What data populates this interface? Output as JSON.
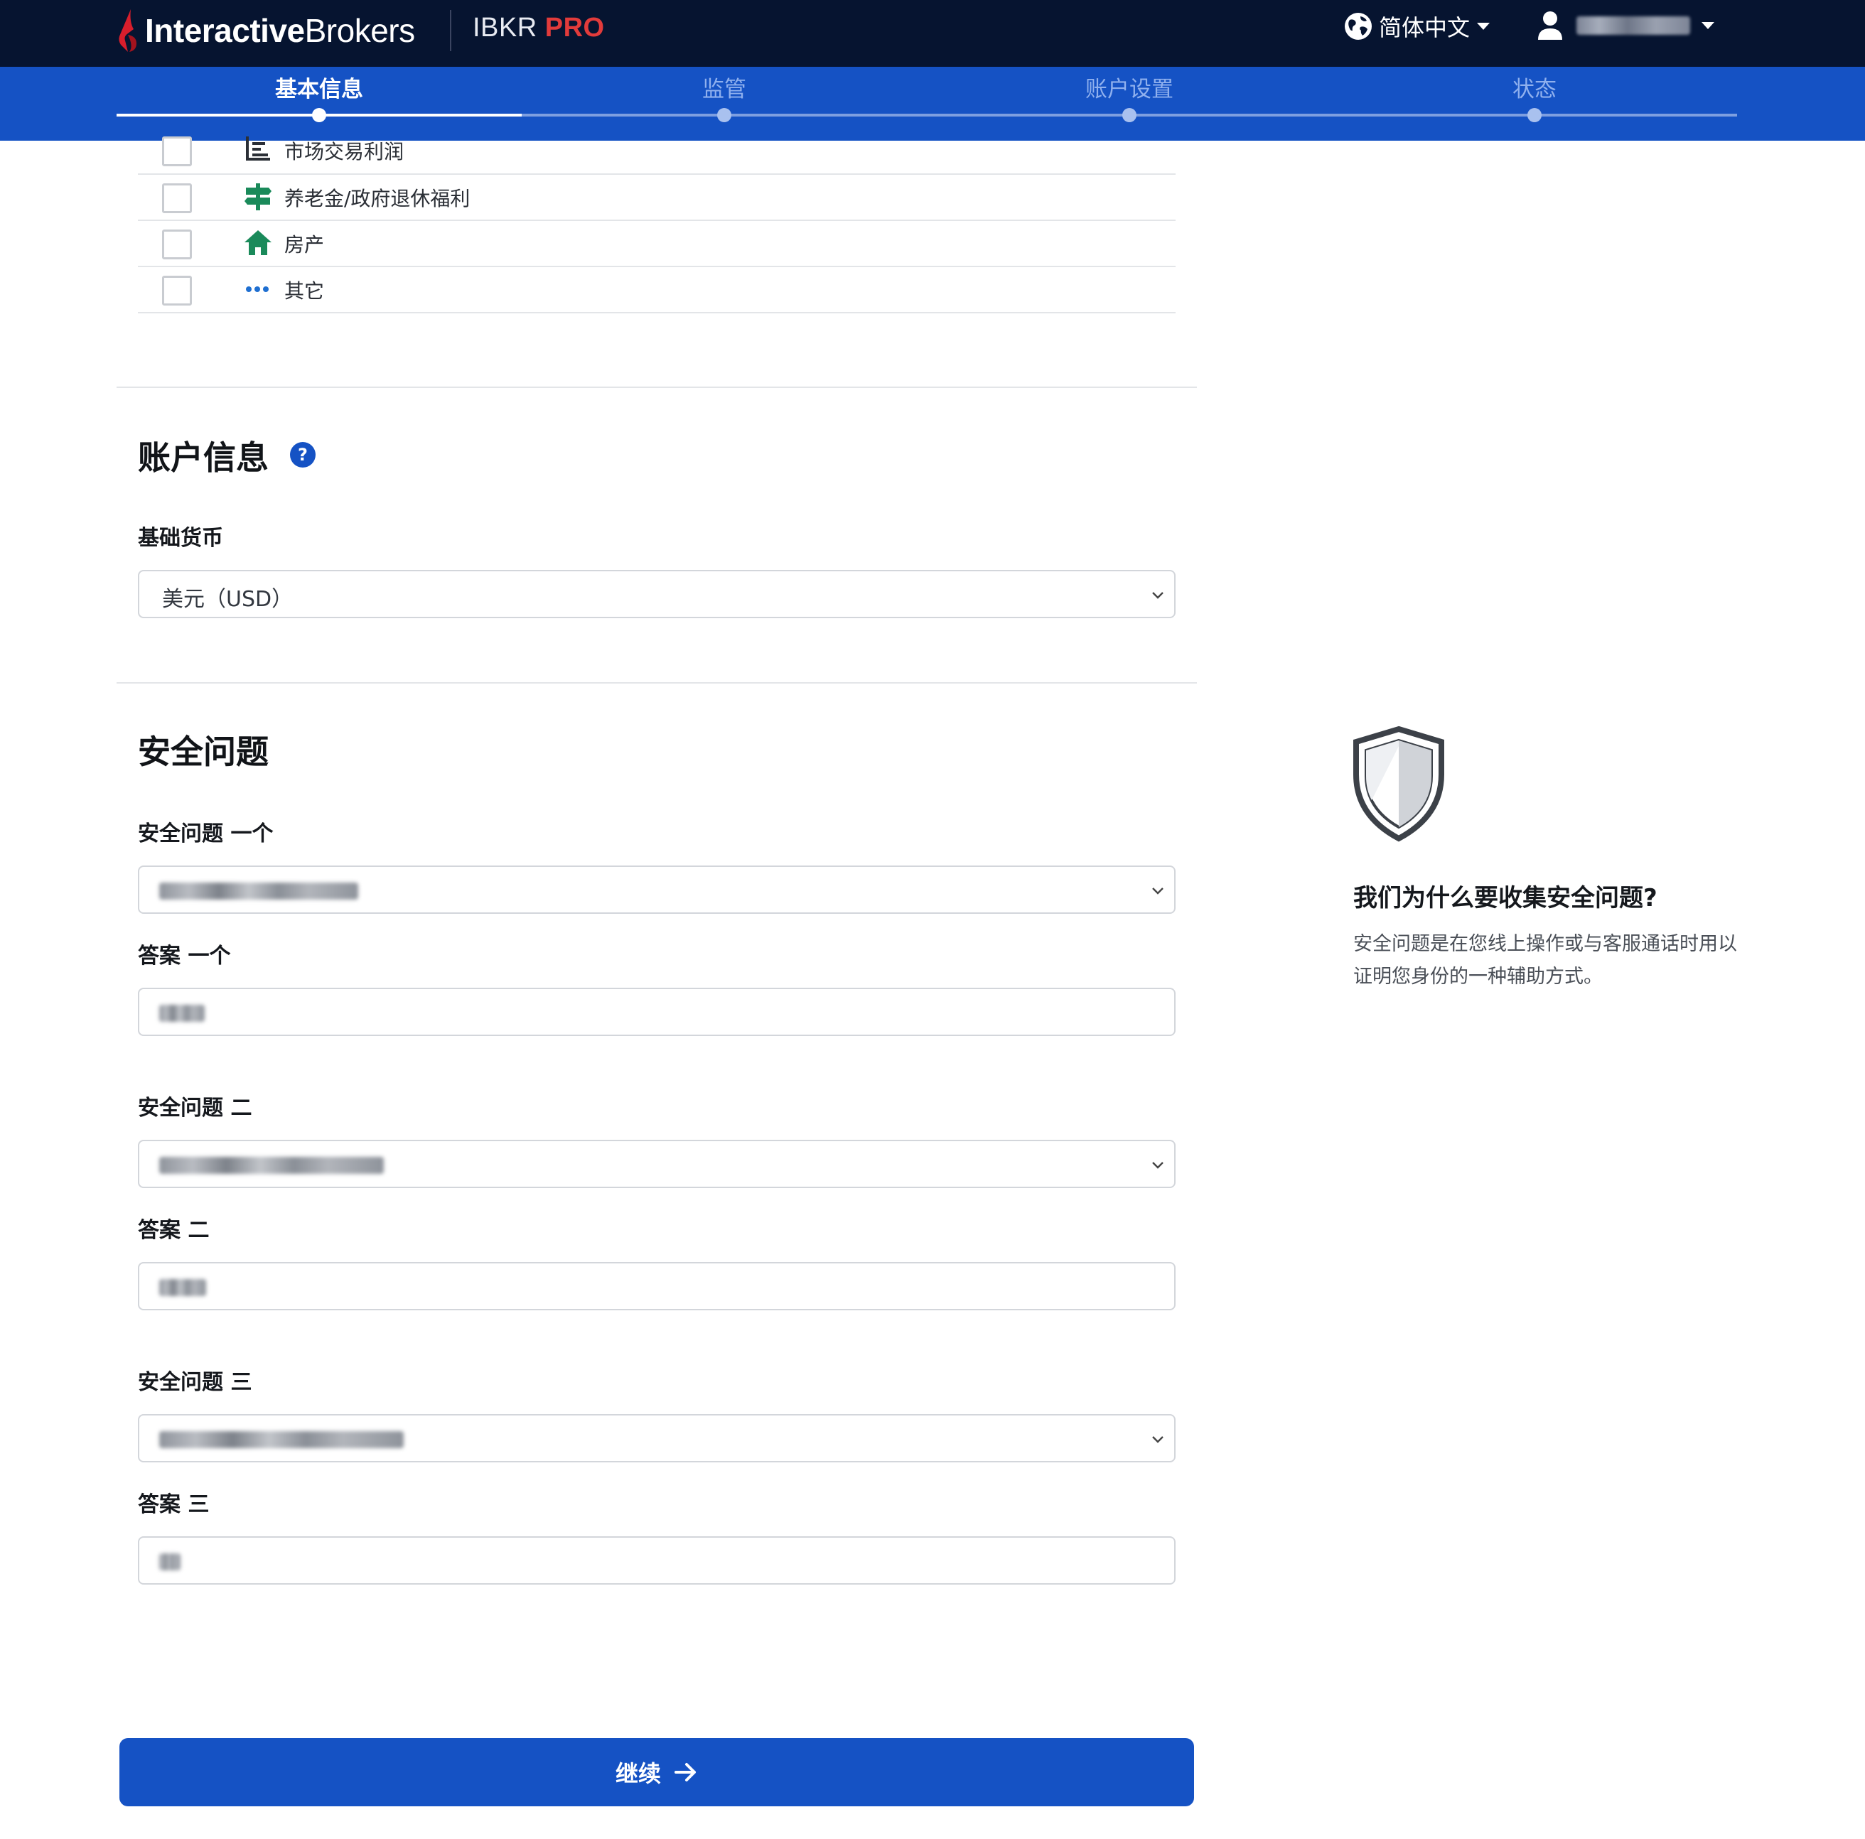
{
  "header": {
    "brand_bold": "Interactive",
    "brand_light": "Brokers",
    "product_name": "IBKR",
    "product_tier": "PRO",
    "language_label": "简体中文"
  },
  "steps": [
    {
      "label": "基本信息",
      "active": true
    },
    {
      "label": "监管",
      "active": false
    },
    {
      "label": "账户设置",
      "active": false
    },
    {
      "label": "状态",
      "active": false
    }
  ],
  "income_sources": [
    {
      "label": "市场交易利润",
      "icon": "chart-icon",
      "checked": false
    },
    {
      "label": "养老金/政府退休福利",
      "icon": "signpost-icon",
      "checked": false
    },
    {
      "label": "房产",
      "icon": "house-icon",
      "checked": false
    },
    {
      "label": "其它",
      "icon": "more-icon",
      "checked": false
    }
  ],
  "account_info": {
    "title": "账户信息",
    "help_icon": "?",
    "base_currency_label": "基础货币",
    "base_currency_value": "美元（USD）"
  },
  "security": {
    "title": "安全问题",
    "question_1_label": "安全问题 一个",
    "answer_1_label": "答案 一个",
    "question_2_label": "安全问题 二",
    "answer_2_label": "答案 二",
    "question_3_label": "安全问题 三",
    "answer_3_label": "答案 三"
  },
  "side_panel": {
    "title": "我们为什么要收集安全问题?",
    "text": "安全问题是在您线上操作或与客服通话时用以证明您身份的一种辅助方式。"
  },
  "continue_label": "继续",
  "colors": {
    "topbar": "#061430",
    "primary": "#1552c4",
    "brand_red": "#e23b3b",
    "icon_green": "#1a8a5a",
    "icon_blue": "#1f6fd1"
  }
}
